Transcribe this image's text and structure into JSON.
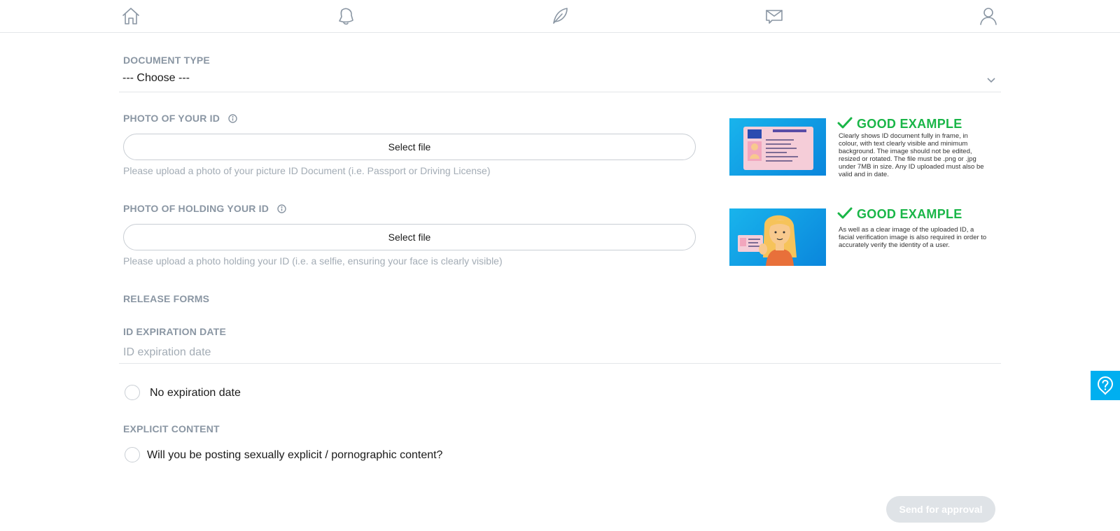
{
  "nav": {
    "items": [
      {
        "name": "home-icon"
      },
      {
        "name": "bell-icon"
      },
      {
        "name": "feather-icon"
      },
      {
        "name": "mail-icon"
      },
      {
        "name": "user-icon"
      }
    ]
  },
  "form": {
    "document_type": {
      "label": "DOCUMENT TYPE",
      "selected": "--- Choose ---"
    },
    "photo_id": {
      "label": "PHOTO OF YOUR ID",
      "button": "Select file",
      "hint": "Please upload a photo of your picture ID Document (i.e. Passport or Driving License)",
      "example_title": "GOOD EXAMPLE",
      "example_text": "Clearly shows ID document fully in frame, in colour, with text clearly visible and minimum background. The image should not be edited, resized or rotated. The file must be .png or .jpg under 7MB in size. Any ID uploaded must also be valid and in date."
    },
    "photo_holding": {
      "label": "PHOTO OF HOLDING YOUR ID",
      "button": "Select file",
      "hint": "Please upload a photo holding your ID (i.e. a selfie, ensuring your face is clearly visible)",
      "example_title": "GOOD EXAMPLE",
      "example_text": "As well as a clear image of the uploaded ID, a facial verification image is also required in order to accurately verify the identity of a user."
    },
    "release_forms": {
      "label": "RELEASE FORMS"
    },
    "expiration": {
      "label": "ID EXPIRATION DATE",
      "placeholder": "ID expiration date",
      "no_expiration_label": "No expiration date"
    },
    "explicit": {
      "label": "EXPLICIT CONTENT",
      "question": "Will you be posting sexually explicit / pornographic content?"
    },
    "submit_label": "Send for approval"
  },
  "colors": {
    "accent": "#00aff0",
    "success": "#1ab648",
    "muted": "#8a96a3"
  }
}
